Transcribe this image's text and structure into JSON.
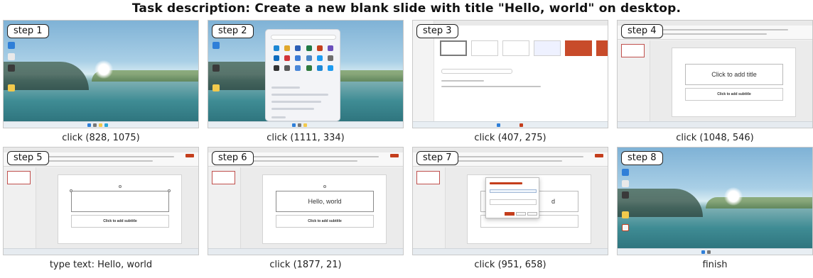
{
  "task_title": "Task description: Create a new blank slide with title \"Hello, world\" on desktop.",
  "steps": [
    {
      "badge": "step 1",
      "caption": "click (828, 1075)"
    },
    {
      "badge": "step 2",
      "caption": "click (1111, 334)"
    },
    {
      "badge": "step 3",
      "caption": "click (407, 275)"
    },
    {
      "badge": "step 4",
      "caption": "click (1048, 546)"
    },
    {
      "badge": "step 5",
      "caption": "type text: Hello, world"
    },
    {
      "badge": "step 6",
      "caption": "click (1877, 21)"
    },
    {
      "badge": "step 7",
      "caption": "click (951, 658)"
    },
    {
      "badge": "step 8",
      "caption": "finish"
    }
  ],
  "slides": {
    "step4_title_placeholder": "Click to add title",
    "subtitle_placeholder": "Click to add subtitle",
    "typed_title": "Hello, world",
    "step7_title_fragment": "d"
  },
  "colors": {
    "office_accent": "#c43e1c",
    "taskbar": "#e8eef3"
  }
}
